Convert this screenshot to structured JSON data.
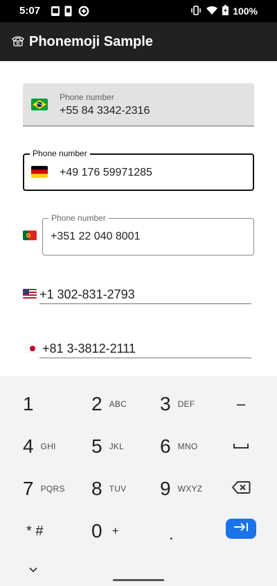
{
  "status_bar": {
    "time": "5:07",
    "battery": "100%",
    "icons": [
      "gallery-icon",
      "sim-icon",
      "data-saver-icon",
      "vibrate-icon",
      "wifi-icon",
      "battery-icon"
    ]
  },
  "app_bar": {
    "icon": "telephone-icon",
    "title": "Phonemoji Sample",
    "background": "#212121"
  },
  "fields": [
    {
      "style": "filled",
      "label": "Phone number",
      "flag": "Brazil",
      "value": "+55 84 3342-2316"
    },
    {
      "style": "outlined-focused",
      "label": "Phone number",
      "flag": "Germany",
      "value": "+49 176 59971285"
    },
    {
      "style": "outlined",
      "label": "Phone number",
      "flag": "Portugal",
      "value": "+351 22 040 8001"
    },
    {
      "style": "underline",
      "flag": "United States",
      "value": "+1 302-831-2793"
    },
    {
      "style": "underline",
      "flag": "Japan",
      "value": "+81 3-3812-2111"
    }
  ],
  "keyboard": {
    "rows": [
      [
        {
          "num": "1",
          "letters": ""
        },
        {
          "num": "2",
          "letters": "ABC"
        },
        {
          "num": "3",
          "letters": "DEF"
        },
        {
          "num": "–",
          "letters": ""
        }
      ],
      [
        {
          "num": "4",
          "letters": "GHI"
        },
        {
          "num": "5",
          "letters": "JKL"
        },
        {
          "num": "6",
          "letters": "MNO"
        },
        {
          "num": "space",
          "letters": ""
        }
      ],
      [
        {
          "num": "7",
          "letters": "PQRS"
        },
        {
          "num": "8",
          "letters": "TUV"
        },
        {
          "num": "9",
          "letters": "WXYZ"
        },
        {
          "num": "backspace",
          "letters": ""
        }
      ],
      [
        {
          "num": "* #",
          "letters": ""
        },
        {
          "num": "0",
          "letters": "+"
        },
        {
          "num": ".",
          "letters": ""
        },
        {
          "num": "next",
          "letters": ""
        }
      ]
    ],
    "enter_color": "#1a73e8",
    "background": "#f2f3f5"
  }
}
